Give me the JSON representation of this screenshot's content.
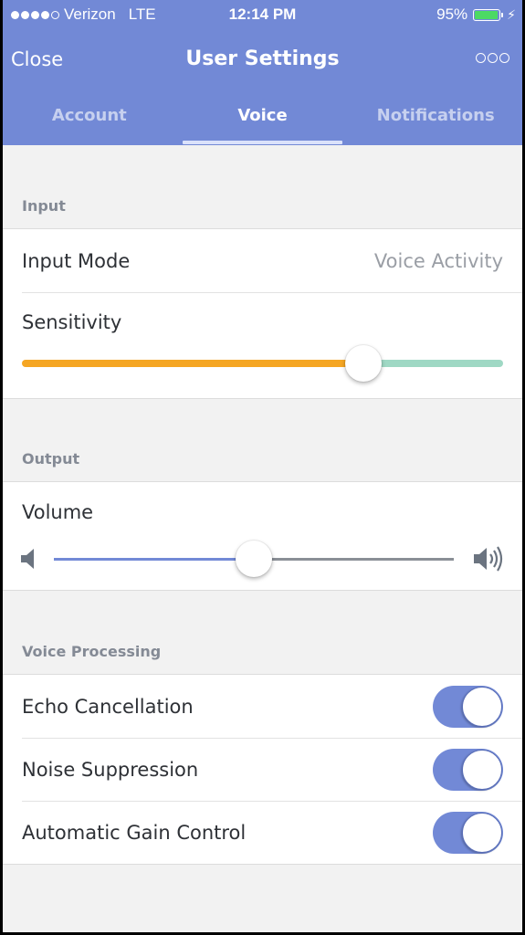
{
  "status_bar": {
    "signal_filled": 4,
    "signal_total": 5,
    "carrier": "Verizon",
    "network": "LTE",
    "time": "12:14 PM",
    "battery_percent_label": "95%",
    "battery_level": 0.95,
    "charging_icon": "bolt-icon"
  },
  "navbar": {
    "close_label": "Close",
    "title": "User Settings",
    "more_icon": "more-options-icon",
    "tabs": [
      {
        "label": "Account",
        "active": false
      },
      {
        "label": "Voice",
        "active": true
      },
      {
        "label": "Notifications",
        "active": false
      }
    ]
  },
  "sections": {
    "input": {
      "header": "Input",
      "input_mode_label": "Input Mode",
      "input_mode_value": "Voice Activity",
      "sensitivity_label": "Sensitivity",
      "sensitivity_value": 0.71
    },
    "output": {
      "header": "Output",
      "volume_label": "Volume",
      "volume_value": 0.5,
      "min_icon": "speaker-low-icon",
      "max_icon": "speaker-high-icon"
    },
    "voice_processing": {
      "header": "Voice Processing",
      "toggles": [
        {
          "label": "Echo Cancellation",
          "on": true
        },
        {
          "label": "Noise Suppression",
          "on": true
        },
        {
          "label": "Automatic Gain Control",
          "on": true
        }
      ]
    }
  },
  "colors": {
    "brand": "#7289d6",
    "sensitivity_active": "#f5a623",
    "sensitivity_inactive": "#9fd8c4",
    "volume_active": "#7289d6",
    "volume_inactive": "#8a8f96",
    "battery_fill": "#4cd964"
  }
}
